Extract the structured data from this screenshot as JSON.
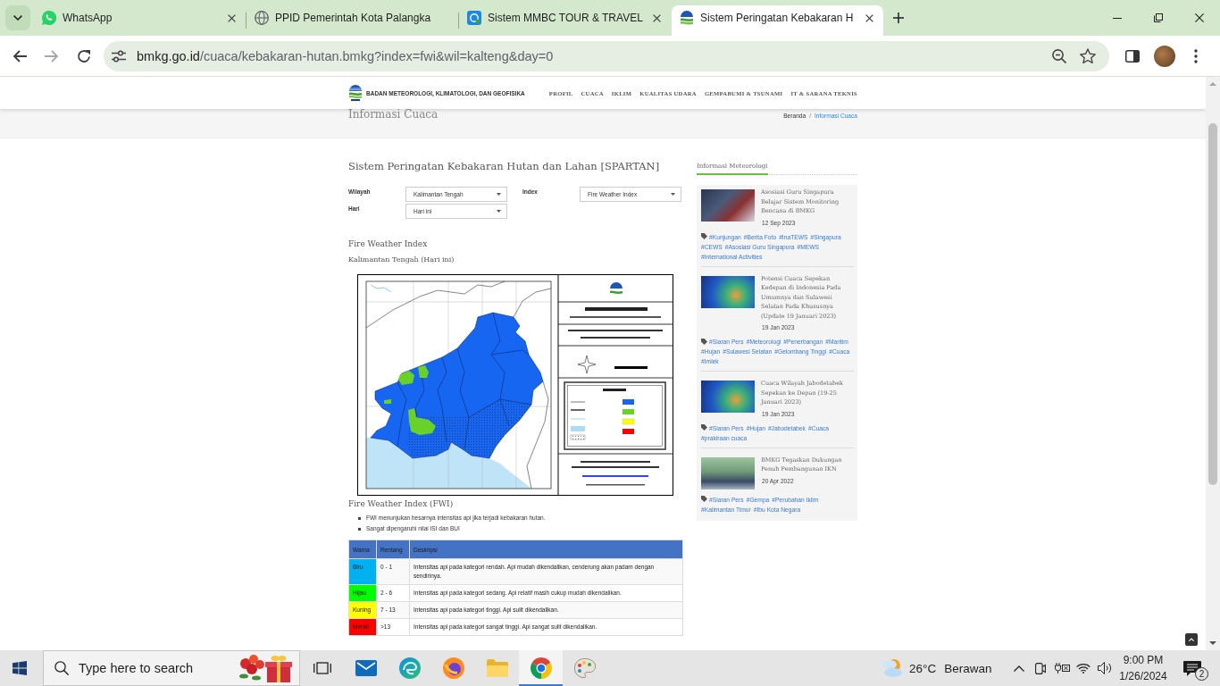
{
  "browser": {
    "tabs": [
      {
        "kind": "chat",
        "title": "WhatsApp",
        "closable": true,
        "selected": false
      },
      {
        "kind": "globe",
        "title": "PPID Pemerintah Kota Palangka",
        "closable": false,
        "selected": false
      },
      {
        "kind": "app",
        "title": "Sistem MMBC TOUR & TRAVEL",
        "closable": true,
        "selected": false
      },
      {
        "kind": "logo",
        "title": "Sistem Peringatan Kebakaran H",
        "closable": true,
        "selected": true
      }
    ],
    "nav_buttons": [
      {
        "kind": "back",
        "disabled": false
      },
      {
        "kind": "forward",
        "disabled": true
      },
      {
        "kind": "reload",
        "disabled": false
      }
    ],
    "address": {
      "domain": "bmkg.go.id",
      "path": "/cuaca/kebakaran-hutan.bmkg?index=fwi&wil=kalteng&day=0"
    }
  },
  "site_header": {
    "brand": "BADAN METEOROLOGI, KLIMATOLOGI, DAN GEOFISIKA",
    "nav": [
      "PROFIL",
      "CUACA",
      "IKLIM",
      "KUALITAS UDARA",
      "GEMPABUMI & TSUNAMI",
      "IT & SARANA TEKNIS"
    ]
  },
  "page_title": {
    "title": "Informasi Cuaca",
    "separator": "/",
    "breadcrumb": [
      {
        "label": "Beranda",
        "current": false
      },
      {
        "label": "Informasi Cuaca",
        "current": true
      }
    ]
  },
  "spartan": {
    "heading": "Sistem Peringatan Kebakaran Hutan dan Lahan [SPARTAN]",
    "filters": [
      {
        "label": "Wilayah",
        "value": "Kalimantan Tengah"
      },
      {
        "label": "Index",
        "value": "Fire Weather Index"
      },
      {
        "label": "Hari",
        "value": "Hari ini"
      }
    ],
    "index_title": "Fire Weather Index",
    "region_title": "Kalimantan Tengah (Hari ini)",
    "fwi": {
      "heading": "Fire Weather Index (FWI)",
      "notes": [
        "FWI menunjukan besarnya intensitas api jika terjadi kebakaran hutan.",
        "Sangat dipengaruhi nilai ISI dan BUI"
      ],
      "table": {
        "columns": [
          "Warna",
          "Rentang",
          "Deskripsi"
        ],
        "rows": [
          {
            "color_name": "Biru",
            "color": "#00b0f0",
            "range": "0 - 1",
            "description": "Intensitas api pada kategori rendah. Api mudah dikendalikan, cenderung akan padam dengan sendirinya."
          },
          {
            "color_name": "Hijau",
            "color": "#00ff00",
            "range": "2 - 6",
            "description": "Intensitas api pada kategori sedang. Api relatif masih cukup mudah dikendalikan."
          },
          {
            "color_name": "Kuning",
            "color": "#ffff00",
            "range": "7 - 13",
            "description": "Intensitas api pada kategori tinggi. Api sulit dikendalikan."
          },
          {
            "color_name": "Merah",
            "color": "#ff0000",
            "range": ">13",
            "description": "Intensitas api pada kategori sangat tinggi. Api sangat sulit dikendalikan."
          }
        ]
      }
    }
  },
  "sidebar": {
    "title": "Informasi Meteorologi",
    "articles": [
      {
        "title": "Asosiasi Guru Singapura Belajar Sistem Monitoring Bencana di BMKG",
        "date": "12 Sep 2023",
        "tags": [
          "#Kunjungan",
          "#Berita Foto",
          "#InaTEWS",
          "#Singapura",
          "#CEWS",
          "#Asosiasi Guru Singapura",
          "#MEWS",
          "#International Activities"
        ]
      },
      {
        "title": "Potensi Cuaca Sepekan Kedepan di Indonesia Pada Umumnya dan Sulawesi Selatan Pada Khususnya (Update 19 Januari 2023)",
        "date": "19 Jan 2023",
        "tags": [
          "#Siaran Pers",
          "#Meteorologi",
          "#Penerbangan",
          "#Maritim",
          "#Hujan",
          "#Sulawesi Selatan",
          "#Gelombang Tinggi",
          "#Cuaca",
          "#Imlek"
        ]
      },
      {
        "title": "Cuaca Wilayah Jabodetabek Sepekan ke Depan (19-25 Januari 2023)",
        "date": "19 Jan 2023",
        "tags": [
          "#Siaran Pers",
          "#Hujan",
          "#Jabodetabek",
          "#Cuaca",
          "#prakiraan cuaca"
        ]
      },
      {
        "title": "BMKG Tegaskan Dukungan Penuh Pembangunan IKN",
        "date": "20 Apr 2022",
        "tags": [
          "#Siaran Pers",
          "#Gempa",
          "#Perubahan Iklim",
          "#Kalimantan Timur",
          "#Ibu Kota Negara"
        ]
      }
    ]
  },
  "taskbar": {
    "search": {
      "placeholder": "Type here to search"
    },
    "apps": [
      {
        "kind": "taskview",
        "active": false
      },
      {
        "kind": "mail",
        "active": false
      },
      {
        "kind": "wave",
        "active": false
      },
      {
        "kind": "fox",
        "active": false
      },
      {
        "kind": "folder",
        "active": false
      },
      {
        "kind": "orb",
        "active": true
      },
      {
        "kind": "palette",
        "active": false
      }
    ],
    "weather": {
      "temperature": "26°C",
      "condition": "Berawan"
    },
    "clock": {
      "time": "9:00 PM",
      "date": "1/26/2024"
    },
    "notifications": {
      "count": "2"
    }
  }
}
